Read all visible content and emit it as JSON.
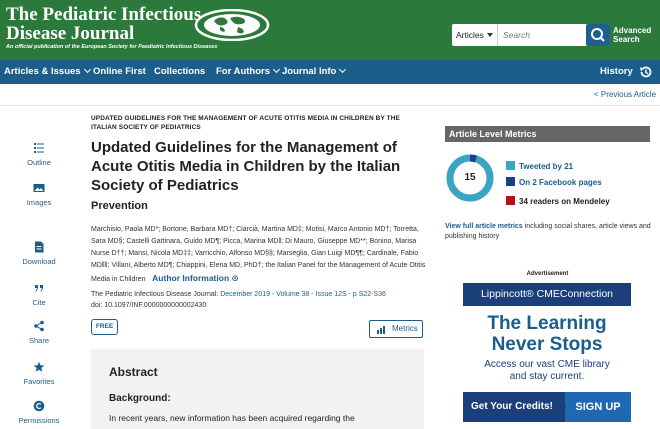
{
  "header": {
    "title_line1": "The Pediatric Infectious",
    "title_line2": "Disease Journal",
    "subtitle": "An official publication of the European Society for Paediatric Infectious Diseases",
    "search": {
      "category": "Articles",
      "placeholder": "Search",
      "advanced_line1": "Advanced",
      "advanced_line2": "Search"
    }
  },
  "nav": {
    "items": [
      "Articles & Issues",
      "Online First",
      "Collections",
      "For Authors",
      "Journal Info"
    ],
    "history": "History"
  },
  "prev_article": "< Previous Article",
  "sidebar": {
    "items": [
      "Outline",
      "Images",
      "Download",
      "Cite",
      "Share",
      "Favorites",
      "Permissions"
    ]
  },
  "article": {
    "kicker": "UPDATED GUIDELINES FOR THE MANAGEMENT OF ACUTE OTITIS MEDIA IN CHILDREN BY THE ITALIAN SOCIETY OF PEDIATRICS",
    "title": "Updated Guidelines for the Management of Acute Otitis Media in Children by the Italian Society of Pediatrics",
    "subtitle": "Prevention",
    "authors": "Marchisio, Paola MD*; Bortone, Barbara MD†; Ciarcià, Martina MD‡; Motisi, Marco Antonio MD†; Torretta, Sara MD§; Castelli Gattinara, Guido MD¶; Picca, Marina MD‖; Di Mauro, Giuseppe MD**; Bonino, Marisa Nurse D††; Mansi, Nicola MD‡‡; Varricchio, Alfonso MD§§; Marseglia, Gian Luigi MD¶¶; Cardinale, Fabio MD‖‖; Villani, Alberto MD¶; Chiappini, Elena MD, PhD†; the Italian Panel for the Management of Acute Otitis Media in Children",
    "author_info": "Author Information",
    "citation_journal": "The Pediatric Infectious Disease Journal:",
    "citation_issue": "December 2019 - Volume 38 - Issue 12S - p S22-S36",
    "doi": "doi: 10.1097/INF.0000000000002430",
    "free_label": "FREE",
    "metrics_label": "Metrics",
    "abstract_title": "Abstract",
    "background_title": "Background:",
    "background_text": "In recent years, new information has been acquired regarding the"
  },
  "metrics_panel": {
    "header": "Article Level Metrics",
    "score": "15",
    "tweeted": "Tweeted by 21",
    "facebook": "On 2 Facebook pages",
    "mendeley": "34 readers on Mendeley",
    "full_link": "View full article metrics",
    "full_text": " including social shares, article views and publishing history"
  },
  "ad": {
    "label": "Advertisement",
    "brand": "Lippincott® CMEConnection",
    "headline_line1": "The Learning",
    "headline_line2": "Never Stops",
    "body_line1": "Access our vast CME library",
    "body_line2": "and stay current.",
    "cta_left": "Get Your Credits!",
    "cta_right": "SIGN UP"
  },
  "colors": {
    "header_green": "#2b7a3b",
    "nav_blue": "#1b5e8c",
    "link_blue": "#1b5e8c",
    "twitter_teal": "#3aa4c4",
    "facebook_blue": "#1f3e8a",
    "mendeley_red": "#b0141c"
  }
}
